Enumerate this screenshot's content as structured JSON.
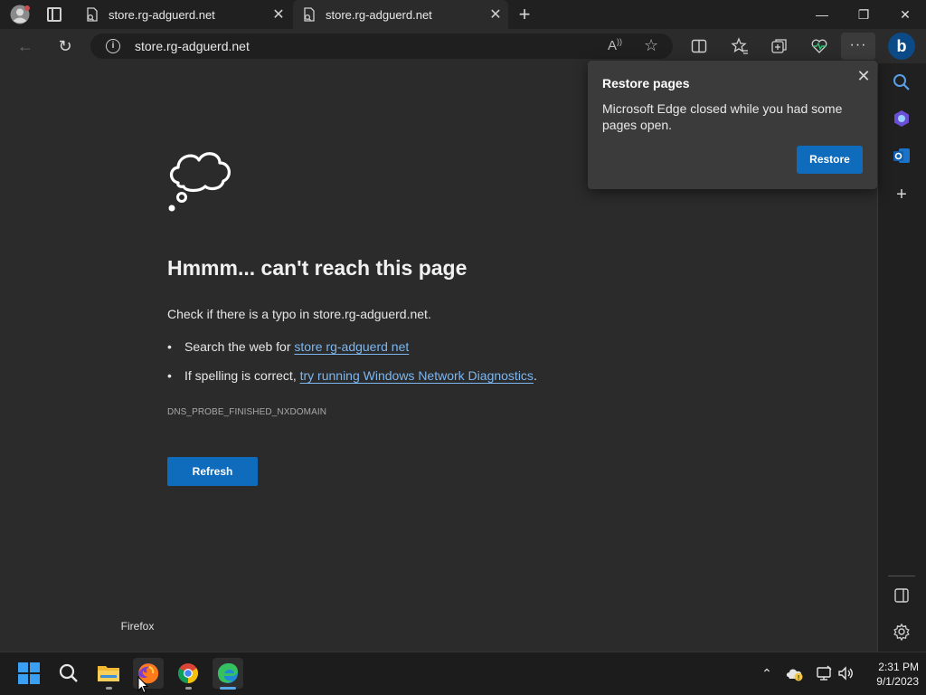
{
  "browser": {
    "tabs": [
      {
        "title": "store.rg-adguerd.net",
        "active": false
      },
      {
        "title": "store.rg-adguerd.net",
        "active": true
      }
    ],
    "new_tab_icon": "plus-icon",
    "window_controls": {
      "minimize": "—",
      "restore": "❐",
      "close": "✕"
    },
    "address_bar": {
      "url": "store.rg-adguerd.net"
    },
    "more_label": "···",
    "bing_label": "b"
  },
  "restore_popup": {
    "title": "Restore pages",
    "body": "Microsoft Edge closed while you had some pages open.",
    "button": "Restore"
  },
  "error_page": {
    "title": "Hmmm... can't reach this page",
    "check_prefix": "Check if there is a typo in ",
    "check_domain": "store.rg-adguerd.net",
    "check_suffix": ".",
    "bullet1_prefix": "Search the web for ",
    "bullet1_link": "store rg-adguerd net",
    "bullet2_prefix": "If spelling is correct, ",
    "bullet2_link": "try running Windows Network Diagnostics",
    "bullet2_suffix": ".",
    "error_code": "DNS_PROBE_FINISHED_NXDOMAIN",
    "refresh_button": "Refresh"
  },
  "taskbar": {
    "tooltip": "Firefox",
    "apps": [
      "start-icon",
      "search-icon",
      "file-explorer-icon",
      "firefox-icon",
      "chrome-icon",
      "edge-icon"
    ],
    "clock_time": "2:31 PM",
    "clock_date": "9/1/2023"
  },
  "colors": {
    "accent": "#0f6cbd",
    "link": "#7cb6f0",
    "page_bg": "#2b2b2b",
    "chrome_bg": "#202020"
  }
}
